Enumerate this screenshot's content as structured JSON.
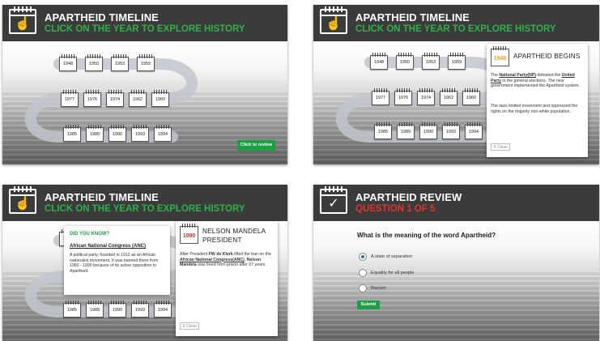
{
  "timeline": {
    "title": "APARTHEID TIMELINE",
    "subtitle": "CLICK ON THE YEAR  TO EXPLORE HISTORY",
    "years_row1": [
      "1948",
      "1950",
      "1953",
      "1959"
    ],
    "years_row2": [
      "1977",
      "1976",
      "1974",
      "1962",
      "1960"
    ],
    "years_row3": [
      "1985",
      "1989",
      "1990",
      "1993",
      "1994"
    ],
    "review_button": "Click to review"
  },
  "panel2": {
    "year": "1948",
    "heading": "APARTHEID BEGINS",
    "para1_pre": "The ",
    "para1_link1": "National Party(NP)",
    "para1_mid": " defeated the ",
    "para1_link2": "United Party",
    "para1_post": " in the general elections. The new government implemented the Apartheid system.",
    "para2": "The laws limited movement and oppressed the rights on the majority non-white population.",
    "close": "X Close"
  },
  "panel3": {
    "did_you_know": "DID YOU KNOW?",
    "term": "African National Congress (ANC)",
    "term_body": "A political party, founded in 1912 as an African nationalist movement. It was banned there from 1960 - 1990 because of its active opposition to Apartheid.",
    "year": "1990",
    "heading": "NELSON MANDELA PRESIDENT",
    "body_pre": "After President ",
    "body_bold1": "FW de Klerk",
    "body_mid1": " lifted the ban on the ",
    "body_link": "African National Congress(ANC)",
    "body_mid2": ", ",
    "body_bold2": "Nelson Mandela",
    "body_post": " was freed from prison after 27 years.",
    "close": "X Close"
  },
  "review": {
    "title": "APARTHEID REVIEW",
    "subtitle": "QUESTION 1 OF 5",
    "question": "What is the meaning of the word Apartheid?",
    "options": [
      "A state of separation",
      "Equality for all people",
      "Racism"
    ],
    "selected_index": 0,
    "submit": "Submit"
  },
  "colors": {
    "header_bg": "#3b3b3b",
    "accent_green": "#2db24a",
    "button_green": "#1c9e45",
    "question_red": "#e0322d",
    "year_highlight_orange": "#f0a020",
    "year_highlight_red": "#c0392b"
  },
  "icons": {
    "timeline_header": "calendar-hand-pointer-icon",
    "review_header": "calendar-checkmark-icon",
    "timeline_entry": "calendar-icon"
  }
}
